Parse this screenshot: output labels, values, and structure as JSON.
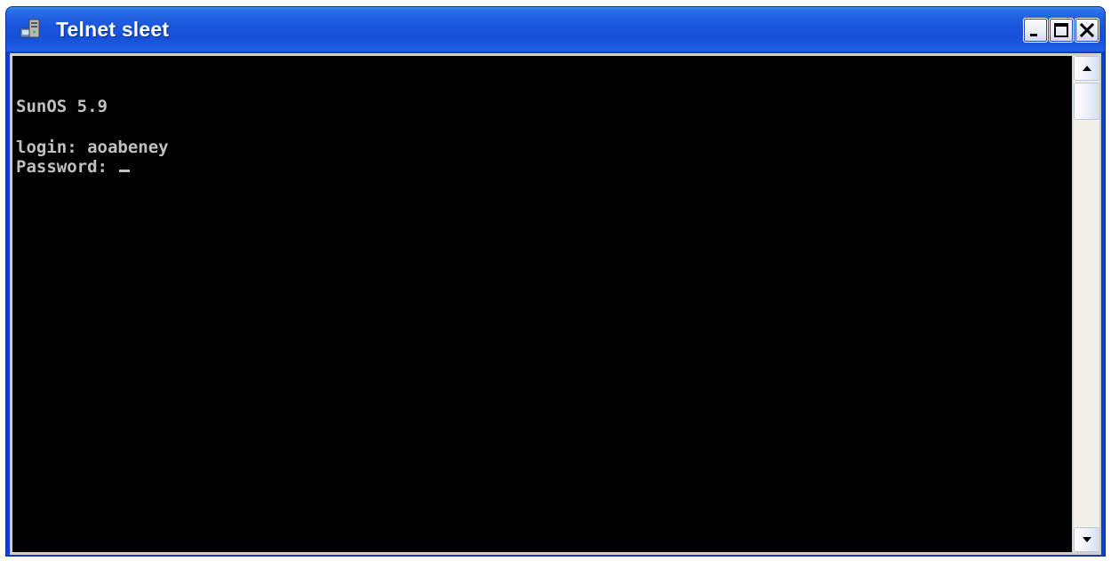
{
  "window": {
    "title": "Telnet sleet"
  },
  "terminal": {
    "lines": [
      "SunOS 5.9",
      "",
      "login: aoabeney",
      "Password: "
    ]
  },
  "icons": {
    "app": "telnet-app-icon",
    "minimize": "minimize-icon",
    "maximize": "maximize-icon",
    "close": "close-icon",
    "scroll_up": "arrow-up-icon",
    "scroll_down": "arrow-down-icon"
  },
  "colors": {
    "titlebar": "#1a57dd",
    "terminal_bg": "#000000",
    "terminal_fg": "#c0c0c0"
  }
}
